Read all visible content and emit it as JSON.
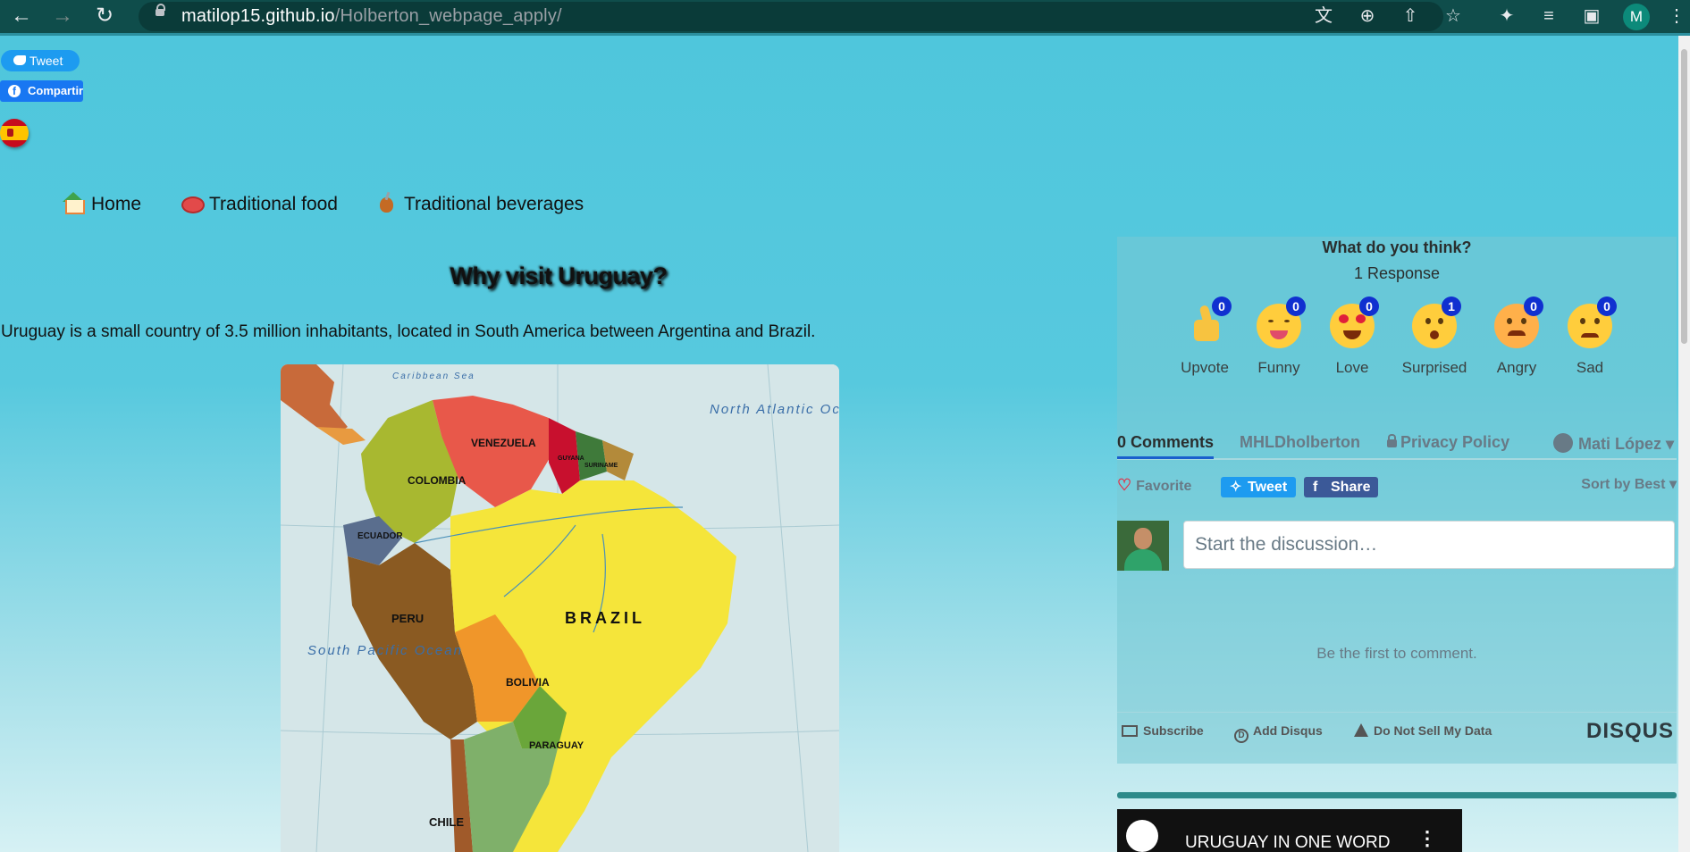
{
  "browser": {
    "url_host": "matilop15.github.io",
    "url_path": "/Holberton_webpage_apply/",
    "avatar_letter": "M",
    "nav_icons": [
      "back-icon",
      "forward-icon",
      "reload-icon"
    ],
    "toolbar_icons": [
      "translate-icon",
      "zoom-icon",
      "share-icon",
      "bookmark-star-icon",
      "extensions-icon",
      "media-icon",
      "sidepanel-icon",
      "menu-icon"
    ]
  },
  "social": {
    "tweet_label": "Tweet",
    "share_label": "Compartir"
  },
  "menu": [
    {
      "label": "Home",
      "icon": "house-icon"
    },
    {
      "label": "Traditional food",
      "icon": "steak-icon"
    },
    {
      "label": "Traditional beverages",
      "icon": "mate-icon"
    }
  ],
  "main": {
    "heading": "Why visit Uruguay?",
    "intro": "Uruguay is a small country of 3.5 million inhabitants, located in South America between Argentina and Brazil.",
    "map_labels": {
      "venezuela": "VENEZUELA",
      "colombia": "COLOMBIA",
      "ecuador": "ECUADOR",
      "peru": "PERU",
      "brazil": "BRAZIL",
      "bolivia": "BOLIVIA",
      "paraguay": "PARAGUAY",
      "chile": "CHILE",
      "guyana": "GUYANA",
      "suriname": "SURINAME",
      "north_atlantic": "North Atlantic Ocean",
      "south_pacific": "South Pacific Ocean",
      "caribbean": "Caribbean Sea"
    }
  },
  "disqus": {
    "question": "What do you think?",
    "responses": "1 Response",
    "reactions": [
      {
        "label": "Upvote",
        "count": "0",
        "icon": "thumbs-up-icon"
      },
      {
        "label": "Funny",
        "count": "0",
        "icon": "funny-face-icon"
      },
      {
        "label": "Love",
        "count": "0",
        "icon": "heart-eyes-icon"
      },
      {
        "label": "Surprised",
        "count": "1",
        "icon": "surprised-face-icon"
      },
      {
        "label": "Angry",
        "count": "0",
        "icon": "angry-face-icon"
      },
      {
        "label": "Sad",
        "count": "0",
        "icon": "sad-face-icon"
      }
    ],
    "tabs": {
      "comments": "0 Comments",
      "community": "MHLDholberton",
      "privacy": "Privacy Policy",
      "user": "Mati López"
    },
    "favorite": "Favorite",
    "tweet": "Tweet",
    "share": "Share",
    "sort": "Sort by Best",
    "input_placeholder": "Start the discussion…",
    "empty": "Be the first to comment.",
    "footer": {
      "subscribe": "Subscribe",
      "add": "Add Disqus",
      "dns": "Do Not Sell My Data",
      "logo": "DISQUS"
    }
  },
  "video": {
    "title": "URUGUAY IN ONE WORD"
  }
}
